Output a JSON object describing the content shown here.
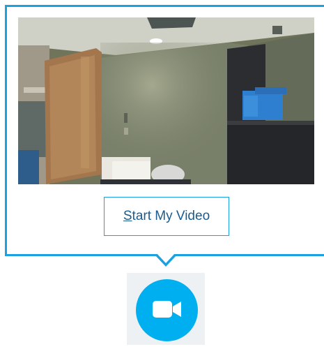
{
  "popup": {
    "start_video_mnemonic": "S",
    "start_video_rest": "tart My Video"
  },
  "icons": {
    "video_toggle": "video-camera-icon"
  },
  "colors": {
    "accent": "#1ba1e2",
    "button_text": "#1b5b8f",
    "camera_button": "#00aff0",
    "tile_bg": "#eef1f4"
  }
}
